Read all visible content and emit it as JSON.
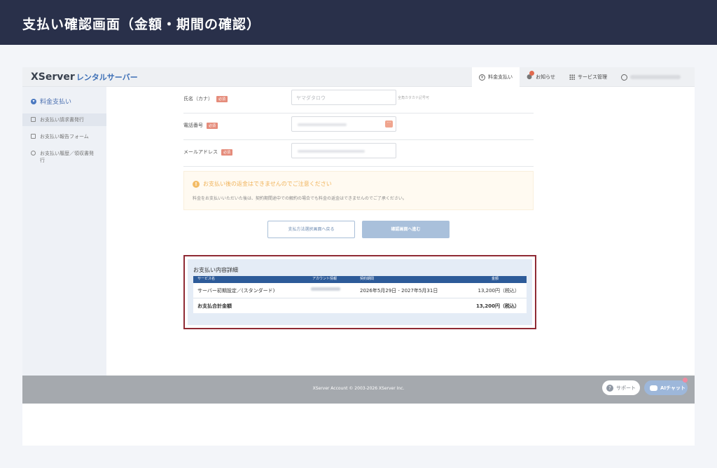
{
  "banner": {
    "title": "支払い確認画面（金額・期間の確認）"
  },
  "appbar": {
    "logo_main": "XServer",
    "logo_sub": "レンタルサーバー",
    "nav": [
      {
        "label": "料金支払い",
        "icon": "yen-icon"
      },
      {
        "label": "お知らせ",
        "icon": "bell-icon"
      },
      {
        "label": "サービス管理",
        "icon": "grid-icon"
      }
    ]
  },
  "sidebar": {
    "heading": "料金支払い",
    "items": [
      {
        "label": "お支払い請求書発行",
        "icon": "invoice-icon"
      },
      {
        "label": "お支払い報告フォーム",
        "icon": "form-icon"
      },
      {
        "label": "お支払い履歴／領収書発行",
        "icon": "clock-icon"
      }
    ]
  },
  "form": {
    "name_kana_label": "氏名（カナ）",
    "name_kana_placeholder": "ヤマダタロウ",
    "name_kana_hint": "全角カタカナ記号可",
    "phone_label": "電話番号",
    "email_label": "メールアドレス",
    "required": "必須"
  },
  "notice": {
    "title": "お支払い後の返金はできませんのでご注意ください",
    "text": "料金をお支払いいただいた後は、契約期間途中での解約の場合でも料金の返金はできませんのでご了承ください。"
  },
  "buttons": {
    "back": "支払方法選択画面へ戻る",
    "next": "確認画面へ進む"
  },
  "detail": {
    "title": "お支払い内容詳細",
    "headers": [
      "サービス名",
      "アカウント情報",
      "契約期間",
      "金額"
    ],
    "rows": [
      {
        "service": "サーバー初期設定／(スタンダード)",
        "period": "2026年5月29日 - 2027年5月31日",
        "amount": "13,200円（税込）"
      }
    ],
    "total_label": "お支払合計金額",
    "total_amount": "13,200円（税込）"
  },
  "footer": {
    "copyright": "XServer Account © 2003-2026 XServer Inc.",
    "support": "サポート",
    "ai_chat": "AIチャット"
  }
}
